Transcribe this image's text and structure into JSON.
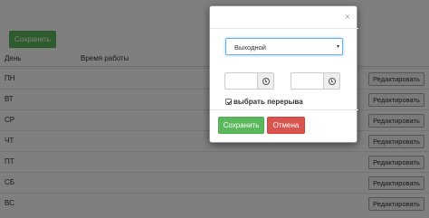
{
  "main": {
    "save_label": "Сохранить",
    "headers": {
      "day": "День",
      "work_time": "Время работы"
    },
    "rows": [
      {
        "day": "ПН",
        "edit_label": "Редактировать"
      },
      {
        "day": "ВТ",
        "edit_label": "Редактировать"
      },
      {
        "day": "СР",
        "edit_label": "Редактировать"
      },
      {
        "day": "ЧТ",
        "edit_label": "Редактировать"
      },
      {
        "day": "ПТ",
        "edit_label": "Редактировать"
      },
      {
        "day": "СБ",
        "edit_label": "Редактировать"
      },
      {
        "day": "ВС",
        "edit_label": "Редактировать"
      }
    ]
  },
  "modal": {
    "close_symbol": "×",
    "day_type_selected": "Выходной",
    "start_time": "",
    "end_time": "",
    "break_checkbox_label": "выбрать перерыва",
    "break_checked": true,
    "save_label": "Сохранить",
    "cancel_label": "Отмена"
  },
  "icons": {
    "clock": "clock-icon",
    "check": "check-icon",
    "close": "close-icon",
    "dropdown": "dropdown-arrow-icon"
  },
  "colors": {
    "success": "#5cb85c",
    "danger": "#d9534f",
    "focus": "#66afe9"
  }
}
